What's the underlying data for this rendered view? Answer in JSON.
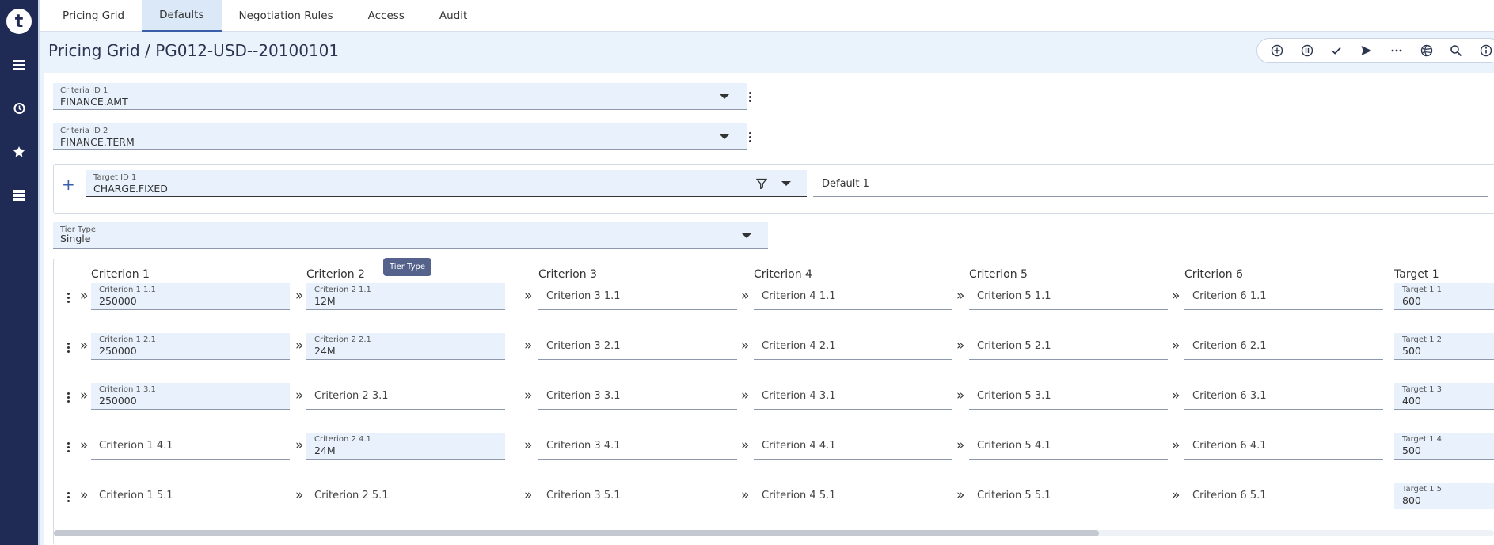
{
  "app": {
    "logo_letter": "t"
  },
  "rail": {
    "icons": [
      "menu-icon",
      "history-icon",
      "star-icon",
      "grid-icon"
    ]
  },
  "tabs": [
    {
      "label": "Pricing Grid",
      "active": false
    },
    {
      "label": "Defaults",
      "active": true
    },
    {
      "label": "Negotiation Rules",
      "active": false
    },
    {
      "label": "Access",
      "active": false
    },
    {
      "label": "Audit",
      "active": false
    }
  ],
  "page": {
    "title": "Pricing Grid / PG012-USD--20100101"
  },
  "toolbar": {
    "icons": [
      "add-circle-icon",
      "pause-circle-icon",
      "check-icon",
      "send-icon",
      "more-icon",
      "globe-icon",
      "search-icon",
      "info-icon"
    ]
  },
  "criteria": [
    {
      "label": "Criteria ID 1",
      "value": "FINANCE.AMT"
    },
    {
      "label": "Criteria ID 2",
      "value": "FINANCE.TERM"
    }
  ],
  "target": {
    "label": "Target ID 1",
    "value": "CHARGE.FIXED",
    "default_text": "Default 1",
    "add_symbol": "+"
  },
  "tier_type": {
    "label": "Tier Type",
    "value": "Single",
    "tooltip": "Tier Type"
  },
  "grid": {
    "columns": [
      "Criterion 1",
      "Criterion 2",
      "Criterion 3",
      "Criterion 4",
      "Criterion 5",
      "Criterion 6",
      "Target 1"
    ],
    "rows": [
      [
        {
          "label": "Criterion 1 1.1",
          "value": "250000"
        },
        {
          "label": "Criterion 2 1.1",
          "value": "12M"
        },
        {
          "placeholder": "Criterion 3 1.1"
        },
        {
          "placeholder": "Criterion 4 1.1"
        },
        {
          "placeholder": "Criterion 5 1.1"
        },
        {
          "placeholder": "Criterion 6 1.1"
        },
        {
          "label": "Target 1 1",
          "value": "600"
        }
      ],
      [
        {
          "label": "Criterion 1 2.1",
          "value": "250000"
        },
        {
          "label": "Criterion 2 2.1",
          "value": "24M"
        },
        {
          "placeholder": "Criterion 3 2.1"
        },
        {
          "placeholder": "Criterion 4 2.1"
        },
        {
          "placeholder": "Criterion 5 2.1"
        },
        {
          "placeholder": "Criterion 6 2.1"
        },
        {
          "label": "Target 1 2",
          "value": "500"
        }
      ],
      [
        {
          "label": "Criterion 1 3.1",
          "value": "250000"
        },
        {
          "placeholder": "Criterion 2 3.1"
        },
        {
          "placeholder": "Criterion 3 3.1"
        },
        {
          "placeholder": "Criterion 4 3.1"
        },
        {
          "placeholder": "Criterion 5 3.1"
        },
        {
          "placeholder": "Criterion 6 3.1"
        },
        {
          "label": "Target 1 3",
          "value": "400"
        }
      ],
      [
        {
          "placeholder": "Criterion 1 4.1"
        },
        {
          "label": "Criterion 2 4.1",
          "value": "24M"
        },
        {
          "placeholder": "Criterion 3 4.1"
        },
        {
          "placeholder": "Criterion 4 4.1"
        },
        {
          "placeholder": "Criterion 5 4.1"
        },
        {
          "placeholder": "Criterion 6 4.1"
        },
        {
          "label": "Target 1 4",
          "value": "500"
        }
      ],
      [
        {
          "placeholder": "Criterion 1 5.1"
        },
        {
          "placeholder": "Criterion 2 5.1"
        },
        {
          "placeholder": "Criterion 3 5.1"
        },
        {
          "placeholder": "Criterion 4 5.1"
        },
        {
          "placeholder": "Criterion 5 5.1"
        },
        {
          "placeholder": "Criterion 6 5.1"
        },
        {
          "label": "Target 1 5",
          "value": "800"
        }
      ]
    ]
  },
  "colors": {
    "rail": "#1f2a55",
    "accent": "#3b5fa8",
    "field_bg": "#e8f1fc",
    "tooltip_bg": "#55638c"
  }
}
